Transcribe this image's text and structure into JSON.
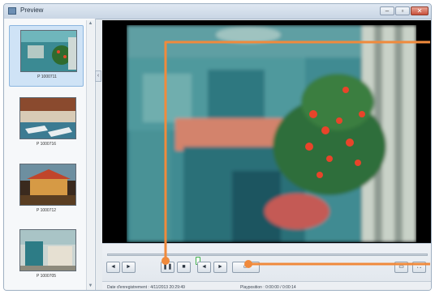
{
  "window": {
    "title": "Preview"
  },
  "titlebar_buttons": {
    "minimize": "–",
    "maximize": "▫",
    "close": "✕"
  },
  "thumbnails": [
    {
      "label": "P 1000711",
      "selected": true
    },
    {
      "label": "P 1000716",
      "selected": false
    },
    {
      "label": "P 1000712",
      "selected": false
    },
    {
      "label": "P 1000705",
      "selected": false
    }
  ],
  "sidebar_scroll": {
    "up": "▲",
    "down": "▼"
  },
  "collapse_handle": {
    "symbol": "‹"
  },
  "controls": {
    "prev": "◄",
    "next": "►",
    "play_pause": "❚❚",
    "stop": "■",
    "frame_back": "◄",
    "frame_forward": "►",
    "snapshot": "▭",
    "right_a": "▭",
    "right_b": "⛶"
  },
  "status_bar": {
    "date_label": "Date d'enregistrement : 4/11/2013 20:29:49",
    "position_label": "Playposition : 0:00:00 / 0:00:14"
  },
  "colors": {
    "annotation": "#f08a3c",
    "selection": "#cfe3f6",
    "seek_marker": "#3fae49"
  }
}
